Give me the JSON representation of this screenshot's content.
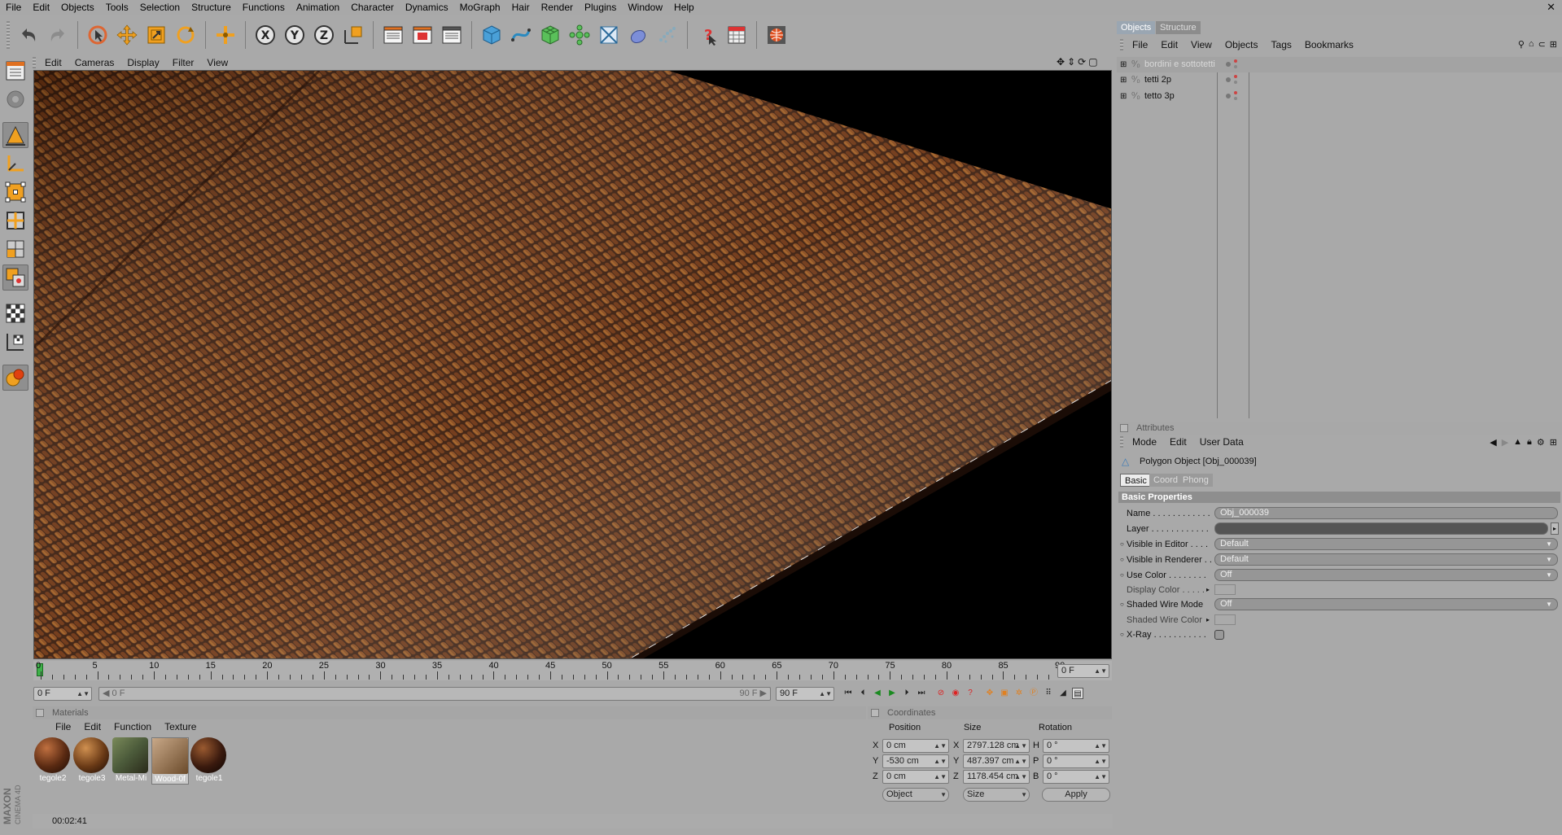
{
  "menubar": {
    "items": [
      "File",
      "Edit",
      "Objects",
      "Tools",
      "Selection",
      "Structure",
      "Functions",
      "Animation",
      "Character",
      "Dynamics",
      "MoGraph",
      "Hair",
      "Render",
      "Plugins",
      "Window",
      "Help"
    ]
  },
  "viewport": {
    "menu": [
      "Edit",
      "Cameras",
      "Display",
      "Filter",
      "View"
    ]
  },
  "timeline": {
    "ticks": [
      "0",
      "5",
      "10",
      "15",
      "20",
      "25",
      "30",
      "35",
      "40",
      "45",
      "50",
      "55",
      "60",
      "65",
      "70",
      "75",
      "80",
      "85",
      "90"
    ],
    "current_frame_box": "0 F",
    "start_field": "0 F",
    "range_start": "0 F",
    "range_end": "90 F",
    "end_field": "90 F"
  },
  "materials": {
    "title": "Materials",
    "menu": [
      "File",
      "Edit",
      "Function",
      "Texture"
    ],
    "items": [
      {
        "name": "tegole2",
        "color": "#5a2a12"
      },
      {
        "name": "tegole3",
        "color": "#6a3a16"
      },
      {
        "name": "Metal-Mi",
        "color": "#4b5a3a"
      },
      {
        "name": "Wood-0f",
        "color": "#9a7a5a"
      },
      {
        "name": "tegole1",
        "color": "#3a1a0e"
      }
    ]
  },
  "coordinates": {
    "title": "Coordinates",
    "col_position": "Position",
    "col_size": "Size",
    "col_rotation": "Rotation",
    "rows": [
      {
        "axis": "X",
        "pos": "0 cm",
        "size_axis": "X",
        "size": "2797.128 cm",
        "rot_axis": "H",
        "rot": "0 °"
      },
      {
        "axis": "Y",
        "pos": "-530 cm",
        "size_axis": "Y",
        "size": "487.397 cm",
        "rot_axis": "P",
        "rot": "0 °"
      },
      {
        "axis": "Z",
        "pos": "0 cm",
        "size_axis": "Z",
        "size": "1178.454 cm",
        "rot_axis": "B",
        "rot": "0 °"
      }
    ],
    "mode": "Object",
    "size_mode": "Size",
    "apply": "Apply"
  },
  "status": {
    "text": "00:02:41"
  },
  "objects": {
    "tabs": [
      "Objects",
      "Structure"
    ],
    "menu": [
      "File",
      "Edit",
      "View",
      "Objects",
      "Tags",
      "Bookmarks"
    ],
    "items": [
      "bordini e sottotetti",
      "tetti 2p",
      "tetto 3p"
    ]
  },
  "attributes": {
    "title": "Attributes",
    "menu": [
      "Mode",
      "Edit",
      "User Data"
    ],
    "object_title": "Polygon Object [Obj_000039]",
    "tabs": [
      "Basic",
      "Coord",
      "Phong"
    ],
    "section": "Basic Properties",
    "props": [
      {
        "label": "Name . . . . . . . . . . . .",
        "value": "Obj_000039"
      },
      {
        "label": "Layer . . . . . . . . . . . .",
        "value": ""
      },
      {
        "label": "Visible in Editor . . . .",
        "value": "Default"
      },
      {
        "label": "Visible in Renderer . .",
        "value": "Default"
      },
      {
        "label": "Use Color . . . . . . . .",
        "value": "Off"
      },
      {
        "label": "Display Color . . . . .",
        "value": ""
      },
      {
        "label": "Shaded Wire Mode",
        "value": "Off"
      },
      {
        "label": "Shaded Wire Color",
        "value": ""
      },
      {
        "label": "X-Ray . . . . . . . . . . .",
        "value": ""
      }
    ]
  },
  "brand": {
    "line1": "MAXON",
    "line2": "CINEMA 4D"
  }
}
